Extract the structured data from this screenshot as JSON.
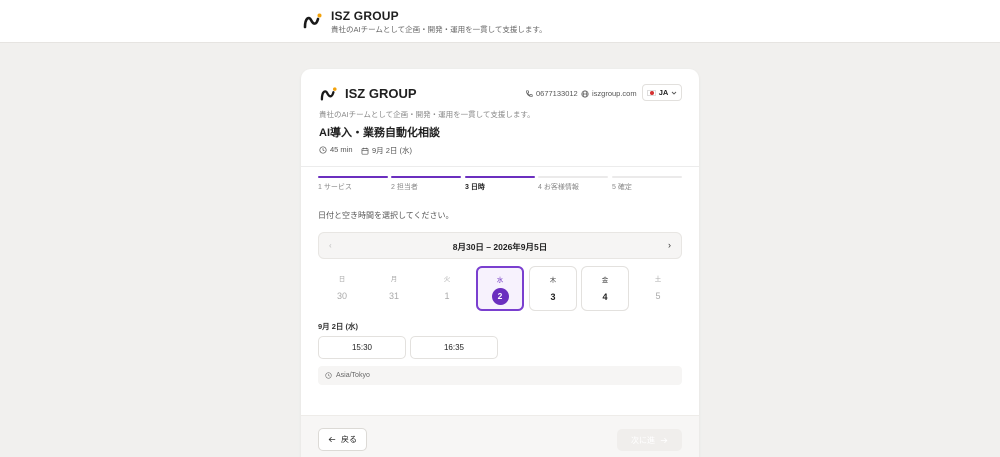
{
  "header": {
    "brand": "ISZ GROUP",
    "tagline": "貴社のAIチームとして企画・開発・運用を一貫して支援します。"
  },
  "card": {
    "brand": "ISZ GROUP",
    "phone": "0677133012",
    "website": "iszgroup.com",
    "language": "JA",
    "description": "貴社のAIチームとして企画・開発・運用を一貫して支援します。",
    "title": "AI導入・業務自動化相談",
    "duration": "45 min",
    "date": "9月 2日 (水)"
  },
  "steps": [
    {
      "label": "1 サービス",
      "state": "done"
    },
    {
      "label": "2 担当者",
      "state": "done"
    },
    {
      "label": "3 日時",
      "state": "active"
    },
    {
      "label": "4 お客様情報",
      "state": "todo"
    },
    {
      "label": "5 確定",
      "state": "todo"
    }
  ],
  "prompt": "日付と空き時間を選択してください。",
  "week": {
    "range": "8月30日 – 2026年9月5日",
    "prev_icon": "chevron-left-icon",
    "next_icon": "chevron-right-icon"
  },
  "days": [
    {
      "weekday": "日",
      "day": "30",
      "state": "disabled"
    },
    {
      "weekday": "月",
      "day": "31",
      "state": "disabled"
    },
    {
      "weekday": "火",
      "day": "1",
      "state": "disabled"
    },
    {
      "weekday": "水",
      "day": "2",
      "state": "selected"
    },
    {
      "weekday": "木",
      "day": "3",
      "state": "available"
    },
    {
      "weekday": "金",
      "day": "4",
      "state": "available"
    },
    {
      "weekday": "土",
      "day": "5",
      "state": "disabled"
    }
  ],
  "selected_date": "9月 2日 (水)",
  "slots": [
    "15:30",
    "16:35"
  ],
  "timezone": "Asia/Tokyo",
  "footer": {
    "back_label": "戻る",
    "next_label": "次に進"
  },
  "colors": {
    "accent": "#6b2fbf",
    "selected_bg": "#f7f2fd",
    "page_bg": "#f1f0ee"
  }
}
